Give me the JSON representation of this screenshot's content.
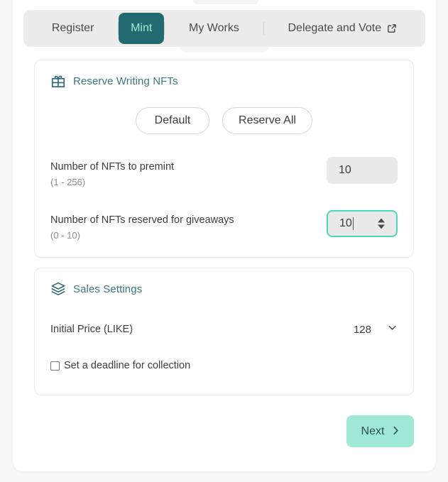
{
  "tabs": [
    {
      "label": "Register",
      "active": false,
      "icon": null
    },
    {
      "label": "Mint",
      "active": true,
      "icon": null
    },
    {
      "label": "My Works",
      "active": false,
      "icon": null
    },
    {
      "label": "Delegate and Vote",
      "active": false,
      "icon": "external-link-icon"
    }
  ],
  "reserve_section": {
    "title": "Reserve Writing NFTs",
    "icon": "gift-icon",
    "buttons": {
      "default_label": "Default",
      "reserve_all_label": "Reserve All"
    },
    "fields": [
      {
        "label": "Number of NFTs to premint",
        "hint": "(1 - 256)",
        "value": "10",
        "focused": false,
        "has_spinner": false
      },
      {
        "label": "Number of NFTs reserved for giveaways",
        "hint": "(0 - 10)",
        "value": "10",
        "focused": true,
        "has_spinner": true
      }
    ]
  },
  "sales_section": {
    "title": "Sales Settings",
    "icon": "layers-icon",
    "price": {
      "label": "Initial Price (LIKE)",
      "value": "128",
      "dropdown_icon": "chevron-down-icon"
    },
    "deadline": {
      "label": "Set a deadline for collection",
      "checked": false
    }
  },
  "footer": {
    "next_label": "Next",
    "next_icon": "chevron-right-icon"
  },
  "colors": {
    "page_bg": "#f7f7f7",
    "card_bg": "#ffffff",
    "tabbar_bg": "#ececec",
    "active_tab_bg": "#226a6f",
    "active_tab_text": "#9fe8d8",
    "section_title": "#3b7680",
    "focus_border": "#4ed6b8",
    "next_bg": "#9fe8d8",
    "next_text": "#2d4f52",
    "input_bg": "#e9e9e9"
  }
}
